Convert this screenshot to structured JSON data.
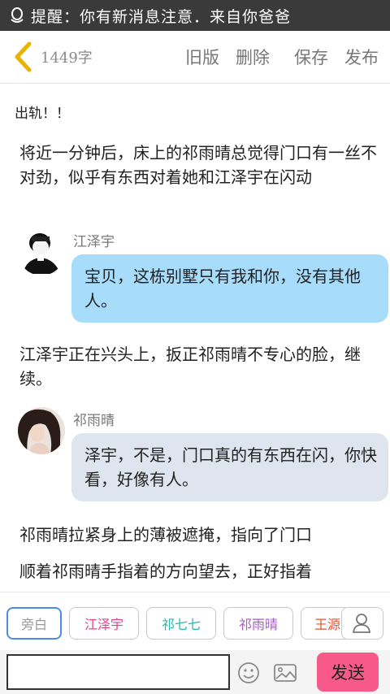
{
  "status_bar": {
    "notification": "提醒：你有新消息注意．来自你爸爸"
  },
  "header": {
    "word_count": "1449字",
    "actions": [
      "旧版",
      "删除",
      "保存",
      "发布"
    ]
  },
  "story": {
    "chapter_title": "出轨！！",
    "narration_1": "将近一分钟后，床上的祁雨晴总觉得门口有一丝不对劲，似乎有东西对着她和江泽宇在闪动",
    "message_1": {
      "name": "江泽宇",
      "text": "宝贝，这栋别墅只有我和你，没有其他人。"
    },
    "narration_2": "江泽宇正在兴头上，扳正祁雨晴不专心的脸，继续。",
    "message_2": {
      "name": "祁雨晴",
      "text": "泽宇，不是，门口真的有东西在闪，你快看，好像有人。"
    },
    "narration_3": "祁雨晴拉紧身上的薄被遮掩，指向了门口",
    "narration_4": "顺着祁雨晴手指着的方向望去，正好指着"
  },
  "roles": [
    {
      "label": "旁白",
      "color": "#9a9a9a"
    },
    {
      "label": "江泽宇",
      "color": "#e0438a"
    },
    {
      "label": "祁七七",
      "color": "#2bb8a4"
    },
    {
      "label": "祁雨晴",
      "color": "#a45fc0"
    },
    {
      "label": "王源",
      "color": "#e0542e"
    }
  ],
  "input": {
    "placeholder": "",
    "send_label": "发送"
  },
  "icons": [
    "qq-icon",
    "back-arrow-icon",
    "add-character-icon",
    "emoji-icon",
    "image-icon"
  ]
}
